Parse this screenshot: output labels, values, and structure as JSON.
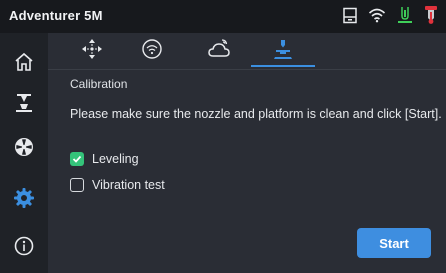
{
  "app": {
    "title": "Adventurer 5M"
  },
  "status_icons": [
    "printer-status-icon",
    "wifi-icon",
    "nozzle-temperature-icon",
    "filament-alert-icon"
  ],
  "sidebar": {
    "items": [
      {
        "icon": "home-icon",
        "active": false
      },
      {
        "icon": "print-job-icon",
        "active": false
      },
      {
        "icon": "fan-icon",
        "active": false
      },
      {
        "icon": "settings-gear-icon",
        "active": true
      },
      {
        "icon": "info-icon",
        "active": false
      }
    ]
  },
  "tabs": [
    {
      "icon": "move-axes-icon",
      "active": false
    },
    {
      "icon": "wifi-settings-icon",
      "active": false
    },
    {
      "icon": "cloud-icon",
      "active": false
    },
    {
      "icon": "calibration-icon",
      "active": true
    }
  ],
  "main": {
    "section_title": "Calibration",
    "instruction": "Please make sure the nozzle and platform is clean and click [Start].",
    "options": [
      {
        "label": "Leveling",
        "checked": true
      },
      {
        "label": "Vibration test",
        "checked": false
      }
    ],
    "start_label": "Start"
  },
  "colors": {
    "accent": "#3e8ee0",
    "checked": "#34c37a",
    "status_green": "#3fcf59",
    "status_red": "#e0323c"
  }
}
